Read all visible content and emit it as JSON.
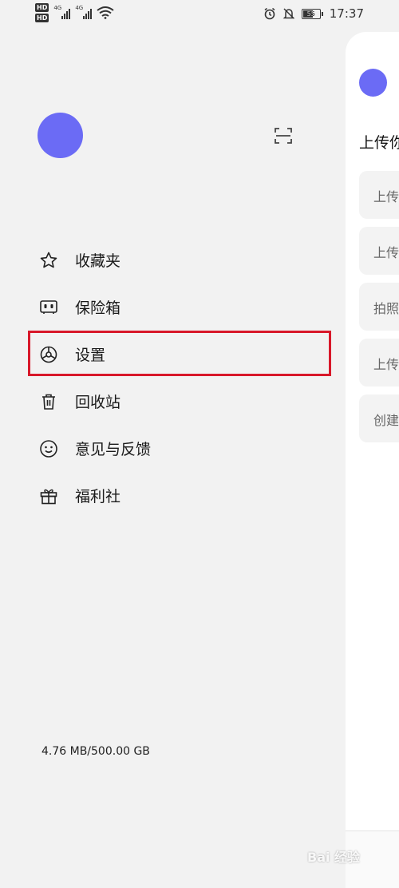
{
  "status_bar": {
    "network_type_1": "4G",
    "network_type_2": "4G",
    "hd_label": "HD",
    "battery_level": "55",
    "time": "17:37"
  },
  "drawer": {
    "menu": [
      {
        "label": "收藏夹",
        "icon": "star-icon"
      },
      {
        "label": "保险箱",
        "icon": "safe-icon"
      },
      {
        "label": "设置",
        "icon": "settings-icon"
      },
      {
        "label": "回收站",
        "icon": "trash-icon"
      },
      {
        "label": "意见与反馈",
        "icon": "smiley-icon"
      },
      {
        "label": "福利社",
        "icon": "gift-icon"
      }
    ],
    "highlighted_item": "设置",
    "highlight_color": "#d8182a",
    "avatar_color": "#6b6bf5",
    "storage_text": "4.76 MB/500.00 GB"
  },
  "background_panel": {
    "title": "上传你",
    "cards": [
      "上传",
      "上传",
      "拍照",
      "上传",
      "创建"
    ]
  },
  "watermark": "Bai 经验"
}
